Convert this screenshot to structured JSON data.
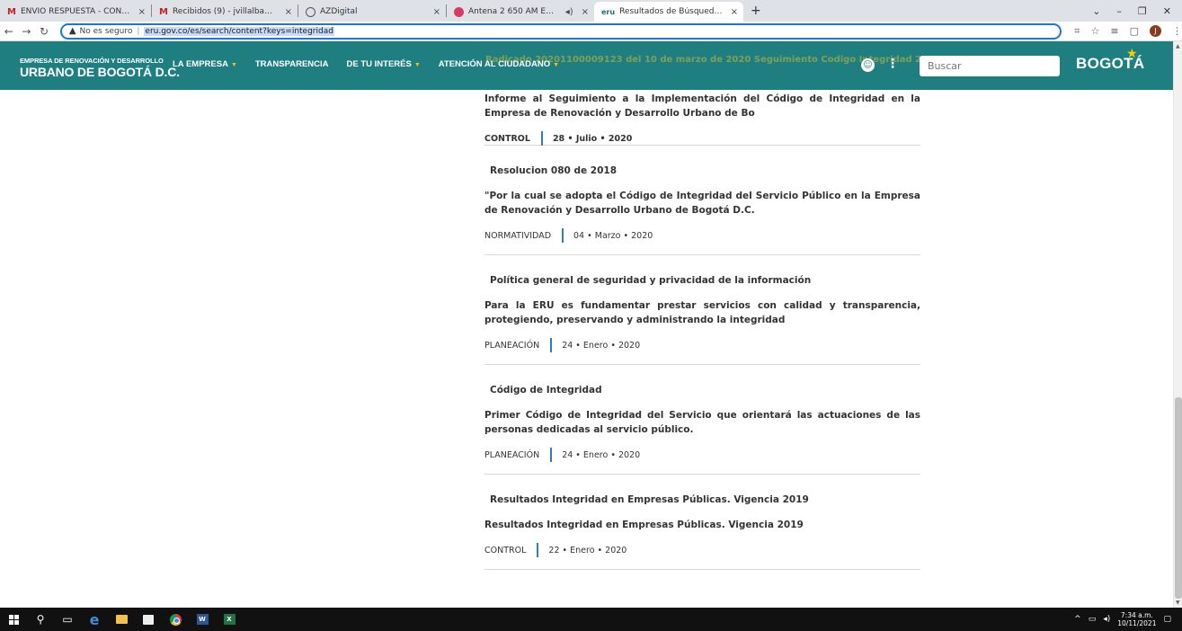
{
  "browser": {
    "tabs": [
      {
        "title": "ENVÍO RESPUESTA - CONCEJO -",
        "favicon": "gmail-icon"
      },
      {
        "title": "Recibidos (9) - jvillalbam@eru.go",
        "favicon": "gmail-icon"
      },
      {
        "title": "AZDigital",
        "favicon": "globe-icon"
      },
      {
        "title": "Antena 2 650 AM En Vivo | R",
        "favicon": "radio-icon"
      },
      {
        "title": "Resultados de Búsqueda | Empre",
        "favicon": "eru-icon",
        "active": true
      }
    ],
    "favicon_text": {
      "gmail": "M",
      "eru": "eru"
    },
    "new_tab": "+",
    "close_glyph": "×",
    "not_secure": "No es seguro",
    "url": "eru.gov.co/es/search/content?keys=integridad",
    "profile_initial": "J"
  },
  "site": {
    "brand_top": "EMPRESA DE RENOVACIÓN Y DESARROLLO",
    "brand_bottom": "URBANO DE BOGOTÁ D.C.",
    "nav": [
      {
        "label": "LA EMPRESA",
        "dropdown": true
      },
      {
        "label": "TRANSPARENCIA",
        "dropdown": false
      },
      {
        "label": "DE TU INTERÉS",
        "dropdown": true
      },
      {
        "label": "ATENCIÓN AL CIUDADANO",
        "dropdown": true
      }
    ],
    "header_overlay_text": "Radicado 20201100009123 del 10 de marzo de 2020 Seguimiento Codigo Integridad 2019",
    "search_placeholder": "Buscar",
    "logo": "BOGOTÁ",
    "accent_color": "#1f7f80",
    "caret_color": "#f5c400"
  },
  "results": [
    {
      "title": "",
      "description": "Informe al Seguimiento a la Implementación del Código de Integridad en la Empresa de Renovación y Desarrollo Urbano de Bo",
      "category": "CONTROL",
      "date": "28 • Julio • 2020",
      "bold_meta": true
    },
    {
      "title": "Resolucion 080 de 2018",
      "description": "\"Por la cual se adopta el Código de Integridad del Servicio Público en la Empresa de Renovación y Desarrollo Urbano de Bogotá D.C.",
      "category": "NORMATIVIDAD",
      "date": "04 • Marzo • 2020",
      "bold_meta": false
    },
    {
      "title": "Política general de seguridad y privacidad de la información",
      "description": "Para la ERU es fundamentar prestar servicios con calidad y transparencia, protegiendo, preservando y administrando la integridad",
      "category": "PLANEACIÓN",
      "date": "24 • Enero • 2020",
      "bold_meta": false
    },
    {
      "title": "Código de Integridad",
      "description": " Primer Código de Integridad del Servicio que orientará las actuaciones de las personas dedicadas al servicio público.",
      "category": "PLANEACIÓN",
      "date": "24 • Enero • 2020",
      "bold_meta": false
    },
    {
      "title": "Resultados Integridad en Empresas Públicas. Vigencia 2019",
      "description": "Resultados Integridad en Empresas Públicas. Vigencia 2019",
      "category": "CONTROL",
      "date": "22 • Enero • 2020",
      "bold_meta": false
    }
  ],
  "taskbar": {
    "time": "7:34 a.m.",
    "date": "10/11/2021",
    "app_labels": {
      "word": "W",
      "excel": "X"
    }
  }
}
